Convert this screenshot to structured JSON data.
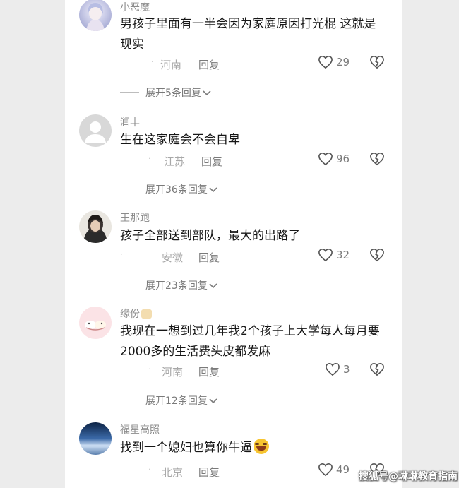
{
  "comments": [
    {
      "username": "小恶魔",
      "text": "男孩子里面有一半会因为家庭原因打光棍 这就是现实",
      "time": "·",
      "location": "河南",
      "reply": "回复",
      "likes": "29",
      "expand": "展开5条回复"
    },
    {
      "username": "润丰",
      "text": "生在这家庭会不会自卑",
      "time": "·",
      "location": "江苏",
      "reply": "回复",
      "likes": "96",
      "expand": "展开36条回复"
    },
    {
      "username": "王那跑",
      "text": "孩子全部送到部队，最大的出路了",
      "time": "·",
      "location": "安徽",
      "reply": "回复",
      "likes": "32",
      "expand": "展开23条回复"
    },
    {
      "username": "缘份",
      "text": "我现在一想到过几年我2个孩子上大学每人每月要2000多的生活费头皮都发麻",
      "time": "·",
      "location": "河南",
      "reply": "回复",
      "likes": "3",
      "expand": "展开12条回复"
    },
    {
      "username": "福星高照",
      "text": "找到一个媳妇也算你牛逼",
      "time": "·",
      "location": "北京",
      "reply": "回复",
      "likes": "49"
    }
  ],
  "watermark": "搜狐号@琳琳教育指南"
}
